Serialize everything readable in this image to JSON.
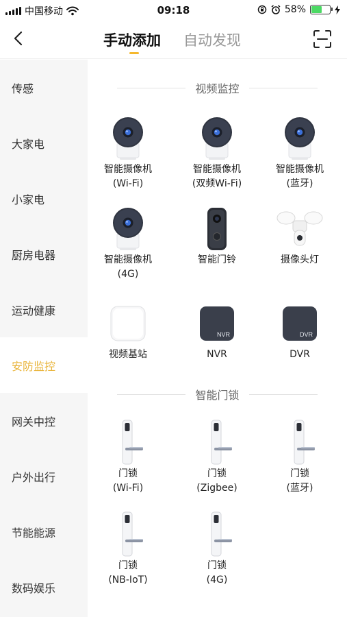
{
  "status_bar": {
    "carrier": "中国移动",
    "time": "09:18",
    "battery": "58%",
    "battery_level": 0.58
  },
  "header": {
    "back_icon": "chevron-left-icon",
    "tab_manual": "手动添加",
    "tab_auto": "自动发现",
    "scan_icon": "scan-icon",
    "accent_color": "#f5b82e"
  },
  "sidebar": {
    "items": [
      {
        "label": "传感"
      },
      {
        "label": "大家电"
      },
      {
        "label": "小家电"
      },
      {
        "label": "厨房电器"
      },
      {
        "label": "运动健康"
      },
      {
        "label": "安防监控"
      },
      {
        "label": "网关中控"
      },
      {
        "label": "户外出行"
      },
      {
        "label": "节能能源"
      },
      {
        "label": "数码娱乐"
      }
    ],
    "active_index": 5,
    "active_color": "#e9b43a"
  },
  "sections": [
    {
      "title": "视频监控",
      "devices": [
        {
          "icon": "camera-icon",
          "line1": "智能摄像机",
          "line2": "(Wi-Fi)"
        },
        {
          "icon": "camera-icon",
          "line1": "智能摄像机",
          "line2": "(双频Wi-Fi)"
        },
        {
          "icon": "camera-icon",
          "line1": "智能摄像机",
          "line2": "(蓝牙)"
        },
        {
          "icon": "camera-icon",
          "line1": "智能摄像机",
          "line2": "(4G)"
        },
        {
          "icon": "doorbell-icon",
          "line1": "智能门铃",
          "line2": ""
        },
        {
          "icon": "floodlight-camera-icon",
          "line1": "摄像头灯",
          "line2": ""
        },
        {
          "icon": "base-station-icon",
          "line1": "视频基站",
          "line2": ""
        },
        {
          "icon": "nvr-icon",
          "line1": "NVR",
          "line2": "",
          "badge": "NVR"
        },
        {
          "icon": "dvr-icon",
          "line1": "DVR",
          "line2": "",
          "badge": "DVR"
        }
      ]
    },
    {
      "title": "智能门锁",
      "devices": [
        {
          "icon": "door-lock-icon",
          "line1": "门锁",
          "line2": "(Wi-Fi)"
        },
        {
          "icon": "door-lock-icon",
          "line1": "门锁",
          "line2": "(Zigbee)"
        },
        {
          "icon": "door-lock-icon",
          "line1": "门锁",
          "line2": "(蓝牙)"
        },
        {
          "icon": "door-lock-icon",
          "line1": "门锁",
          "line2": "(NB-IoT)"
        },
        {
          "icon": "door-lock-icon",
          "line1": "门锁",
          "line2": "(4G)"
        }
      ]
    }
  ]
}
